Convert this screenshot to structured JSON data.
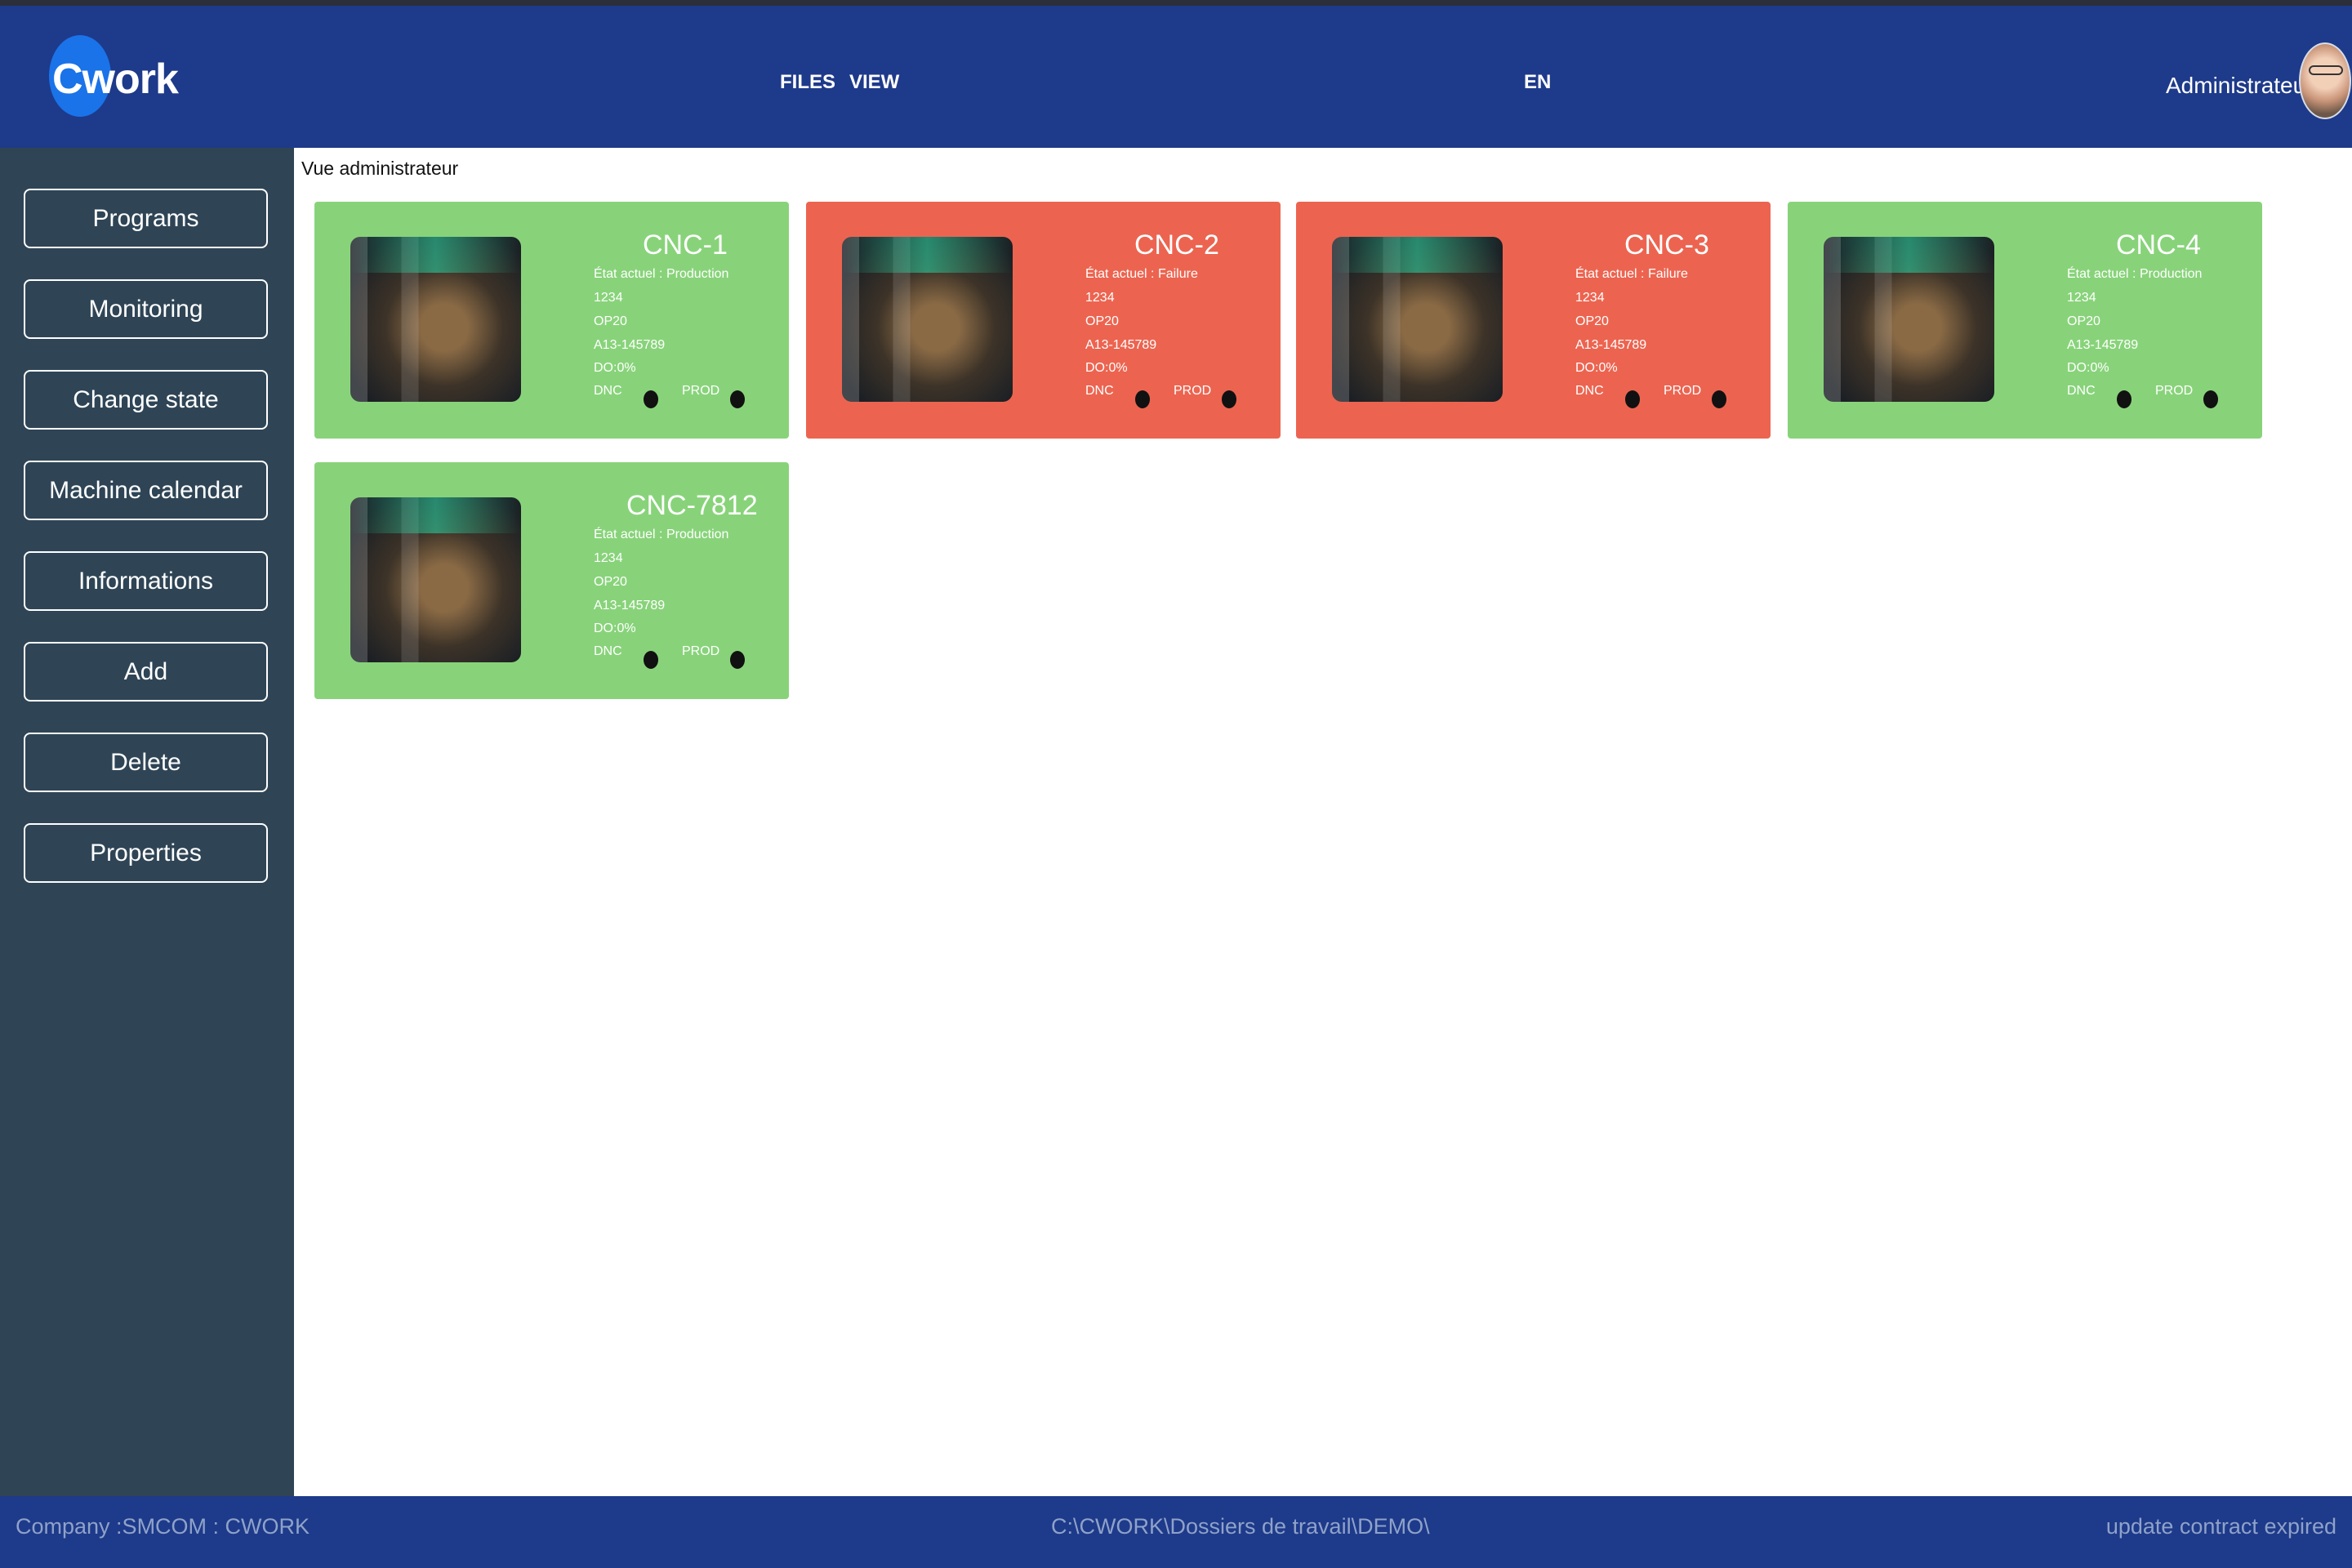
{
  "app": {
    "logo_text": "Cwork",
    "brand_color": "#1e3a8a",
    "sidebar_color": "#2f4556"
  },
  "header": {
    "menu": [
      "FILES",
      "VIEW"
    ],
    "language": "EN",
    "user_name": "Administrateur"
  },
  "sidebar": {
    "items": [
      {
        "label": "Programs"
      },
      {
        "label": "Monitoring"
      },
      {
        "label": "Change state"
      },
      {
        "label": "Machine calendar"
      },
      {
        "label": "Informations"
      },
      {
        "label": "Add"
      },
      {
        "label": "Delete"
      },
      {
        "label": "Properties"
      }
    ]
  },
  "main": {
    "view_title": "Vue administrateur"
  },
  "machines": [
    {
      "name": "CNC-1",
      "state": "État actuel : Production",
      "code": "1234",
      "op": "OP20",
      "ref": "A13-145789",
      "do": "DO:0%",
      "dnc": "DNC",
      "prod": "PROD",
      "status_color": "#88d37a"
    },
    {
      "name": "CNC-2",
      "state": "État actuel : Failure",
      "code": "1234",
      "op": "OP20",
      "ref": "A13-145789",
      "do": "DO:0%",
      "dnc": "DNC",
      "prod": "PROD",
      "status_color": "#ec6450"
    },
    {
      "name": "CNC-3",
      "state": "État actuel : Failure",
      "code": "1234",
      "op": "OP20",
      "ref": "A13-145789",
      "do": "DO:0%",
      "dnc": "DNC",
      "prod": "PROD",
      "status_color": "#ec6450"
    },
    {
      "name": "CNC-4",
      "state": "État actuel : Production",
      "code": "1234",
      "op": "OP20",
      "ref": "A13-145789",
      "do": "DO:0%",
      "dnc": "DNC",
      "prod": "PROD",
      "status_color": "#88d37a"
    },
    {
      "name": "CNC-7812",
      "state": "État actuel : Production",
      "code": "1234",
      "op": "OP20",
      "ref": "A13-145789",
      "do": "DO:0%",
      "dnc": "DNC",
      "prod": "PROD",
      "status_color": "#88d37a"
    }
  ],
  "footer": {
    "company": "Company :SMCOM : CWORK",
    "path": "C:\\CWORK\\Dossiers de travail\\DEMO\\",
    "status": "update contract expired"
  }
}
